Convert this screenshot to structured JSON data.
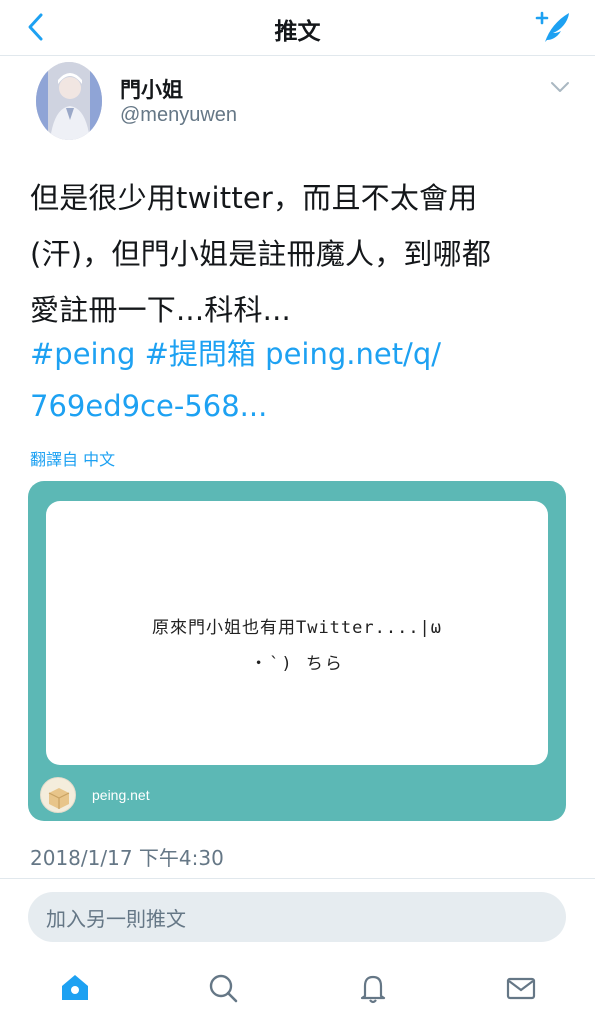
{
  "header": {
    "title": "推文",
    "back_icon": "chevron-left-icon",
    "compose_icon": "compose-tweet-icon",
    "accent_color": "#1da1f2"
  },
  "tweet": {
    "author_name": "門小姐",
    "author_handle": "@menyuwen",
    "text_lines": [
      "但是很少用twitter，而且不太會用",
      "(汗)，但門小姐是註冊魔人，到哪都",
      "愛註冊一下...科科..."
    ],
    "hashtag_1": "#peing",
    "hashtag_2": "#提問箱",
    "link_1": "peing.net/q/",
    "link_2": "769ed9ce-568...",
    "translated_label": "翻譯自 中文",
    "timestamp": "2018/1/17 下午4:30"
  },
  "card": {
    "question_line_1": "原來門小姐也有用Twitter....|ω",
    "question_line_2": "・`) ちら",
    "domain": "peing.net",
    "background_color": "#5cb8b5"
  },
  "reply": {
    "placeholder": "加入另一則推文"
  },
  "tabbar": {
    "items": [
      "home-icon",
      "search-icon",
      "notifications-icon",
      "messages-icon"
    ],
    "active": "home-icon"
  }
}
